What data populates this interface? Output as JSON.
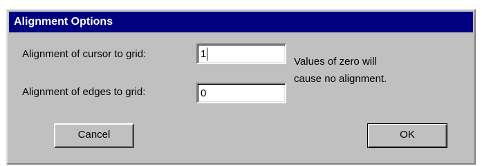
{
  "dialog": {
    "title": "Alignment Options",
    "cursor_label": "Alignment of cursor to grid:",
    "cursor_value": "1",
    "edges_label": "Alignment of edges to grid:",
    "edges_value": "0",
    "note_line1": "Values of zero will",
    "note_line2": "cause no alignment.",
    "cancel_label": "Cancel",
    "ok_label": "OK"
  },
  "colors": {
    "titlebar": "#000080",
    "title_text": "#ffffff",
    "face": "#c0c0c0",
    "field_background": "#ffffff"
  }
}
